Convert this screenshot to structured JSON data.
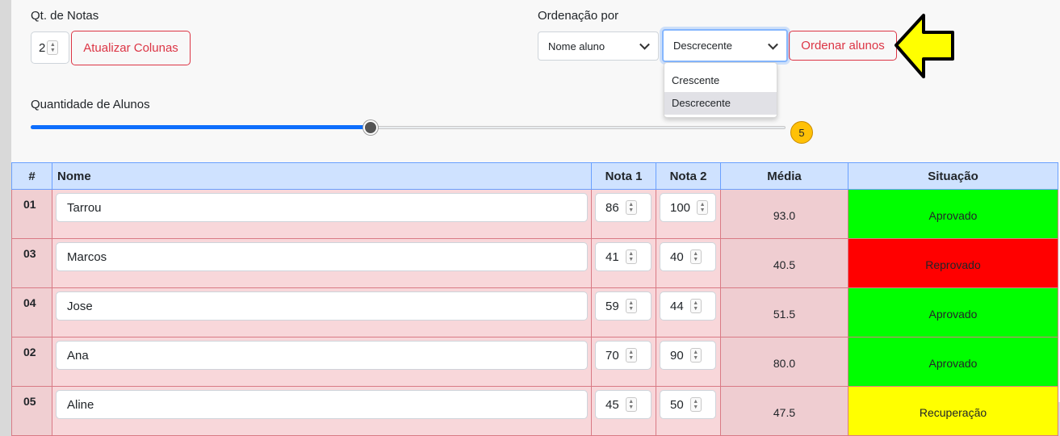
{
  "colors": {
    "approved": "#00ff00",
    "failed": "#ff0000",
    "recovery": "#ffff00",
    "accent": "#0d6efd",
    "danger": "#dc3545",
    "arrow": "#ffff00"
  },
  "controls": {
    "qt_notas_label": "Qt. de Notas",
    "qt_notas_value": "2",
    "update_button": "Atualizar Colunas",
    "ordering_label": "Ordenação por",
    "order_field_value": "Nome aluno",
    "order_direction_value": "Descrecente",
    "order_button": "Ordenar alunos",
    "direction_options": [
      "Crescente",
      "Descrecente"
    ],
    "selected_option": "Descrecente",
    "students_label": "Quantidade de Alunos",
    "students_count": "5",
    "slider_fraction": 0.45
  },
  "table": {
    "headers": [
      "#",
      "Nome",
      "Nota 1",
      "Nota 2",
      "Média",
      "Situação"
    ],
    "rows": [
      {
        "id": "01",
        "name": "Tarrou",
        "nota1": "86",
        "nota2": "100",
        "media": "93.0",
        "situacao": "Aprovado",
        "status": "approved"
      },
      {
        "id": "03",
        "name": "Marcos",
        "nota1": "41",
        "nota2": "40",
        "media": "40.5",
        "situacao": "Reprovado",
        "status": "failed"
      },
      {
        "id": "04",
        "name": "Jose",
        "nota1": "59",
        "nota2": "44",
        "media": "51.5",
        "situacao": "Aprovado",
        "status": "approved"
      },
      {
        "id": "02",
        "name": "Ana",
        "nota1": "70",
        "nota2": "90",
        "media": "80.0",
        "situacao": "Aprovado",
        "status": "approved"
      },
      {
        "id": "05",
        "name": "Aline",
        "nota1": "45",
        "nota2": "50",
        "media": "47.5",
        "situacao": "Recuperação",
        "status": "recovery"
      }
    ]
  }
}
